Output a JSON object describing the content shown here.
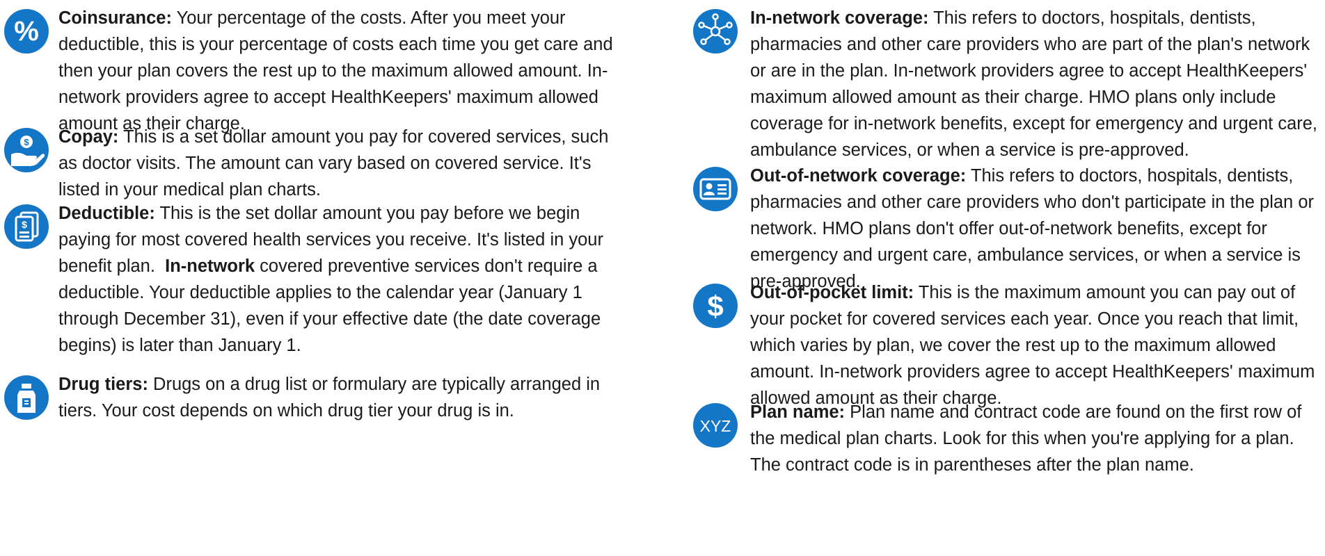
{
  "brand_color": "#1476c6",
  "left_column": [
    {
      "icon": "percent-icon",
      "label": "Coinsurance:",
      "text": "Your percentage of the costs. After you meet your deductible, this is your percentage of costs each time you get care and then your plan covers the rest up to the maximum allowed amount. In-network providers agree to accept HealthKeepers' maximum allowed amount as their charge."
    },
    {
      "icon": "hand-coin-icon",
      "label": "Copay:",
      "text": "This is a set dollar amount you pay for covered services, such as doctor visits. The amount can vary based on covered service. It's listed in your medical plan charts."
    },
    {
      "icon": "bill-document-icon",
      "label": "Deductible:",
      "text_before": "This is the set dollar amount you pay before we begin paying for most covered health services you receive. It's listed in your benefit plan.",
      "text_bold": "In-network",
      "text_after": "covered preventive services don't require a deductible. Your deductible applies to the calendar year (January 1 through December 31), even if your effective date (the date coverage begins) is later than January 1."
    },
    {
      "icon": "medicine-bottle-icon",
      "label": "Drug tiers:",
      "text": "Drugs on a drug list or formulary are typically arranged in tiers. Your cost depends on which drug tier your drug is in."
    }
  ],
  "right_column": [
    {
      "icon": "network-icon",
      "label": "In-network coverage:",
      "text": "This refers to doctors, hospitals, dentists, pharmacies and other care providers who are part of the plan's network or are in the plan. In-network providers agree to accept HealthKeepers' maximum allowed amount as their charge. HMO plans only include coverage for in-network benefits, except for emergency and urgent care, ambulance services, or when a service is pre-approved."
    },
    {
      "icon": "id-card-icon",
      "label": "Out-of-network coverage:",
      "text": "This refers to doctors, hospitals, dentists, pharmacies and other care providers who don't participate in the plan or network. HMO plans don't offer out-of-network benefits, except for emergency and urgent care, ambulance services, or when a service is pre-approved."
    },
    {
      "icon": "dollar-icon",
      "label": "Out-of-pocket limit:",
      "text": "This is the maximum amount you can pay out of your pocket for covered services each year. Once you reach that limit, which varies by plan, we cover the rest up to the maximum allowed amount. In-network providers agree to accept HealthKeepers' maximum allowed amount as their charge."
    },
    {
      "icon": "xyz-icon",
      "icon_text": "XYZ",
      "label": "Plan name:",
      "text": "Plan name and contract code are found on the first row of the medical plan charts. Look for this when you're applying for a plan. The contract code is in parentheses after the plan name."
    }
  ]
}
